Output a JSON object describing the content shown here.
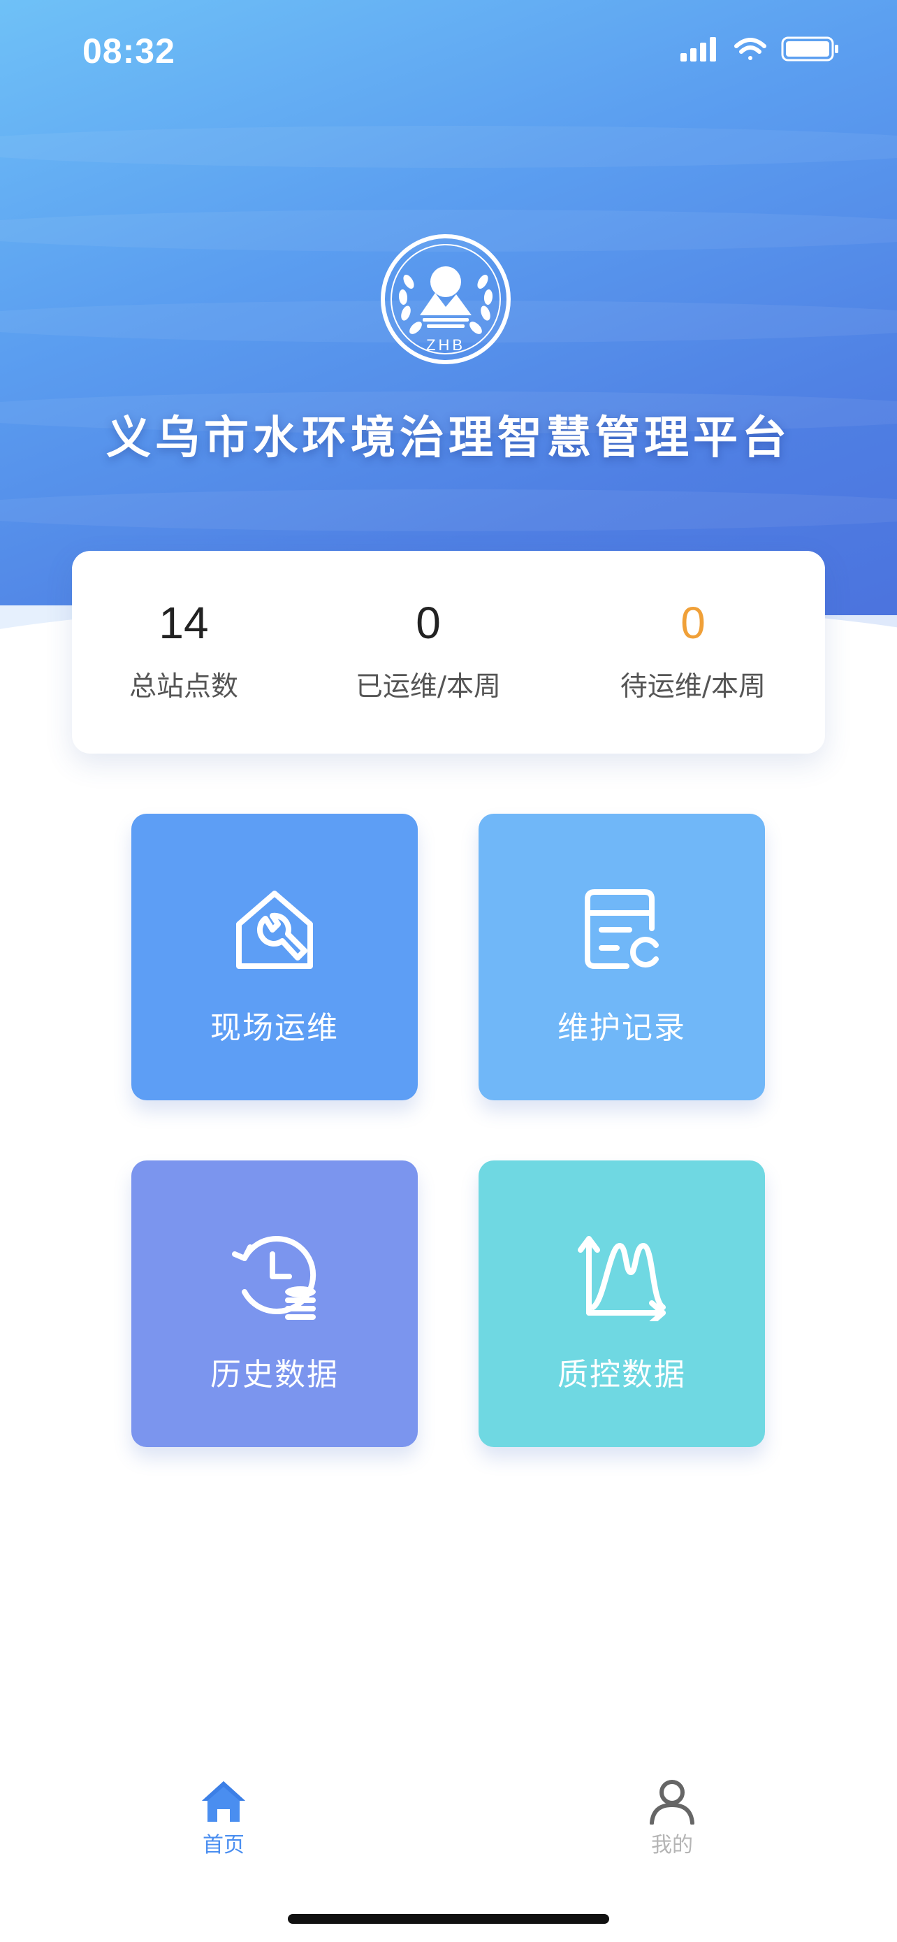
{
  "status_bar": {
    "time": "08:32"
  },
  "header": {
    "title": "义乌市水环境治理智慧管理平台",
    "logo_text": "ZHB"
  },
  "stats": [
    {
      "value": "14",
      "label": "总站点数"
    },
    {
      "value": "0",
      "label": "已运维/本周"
    },
    {
      "value": "0",
      "label": "待运维/本周"
    }
  ],
  "tiles": [
    {
      "label": "现场运维",
      "icon": "house-wrench-icon",
      "color": "#5d9ef5"
    },
    {
      "label": "维护记录",
      "icon": "record-list-icon",
      "color": "#70b7f8"
    },
    {
      "label": "历史数据",
      "icon": "history-database-icon",
      "color": "#7b95ee"
    },
    {
      "label": "质控数据",
      "icon": "peak-chart-icon",
      "color": "#6fd8e2"
    }
  ],
  "tab_bar": {
    "items": [
      {
        "label": "首页",
        "icon": "home-icon",
        "active": true
      },
      {
        "label": "我的",
        "icon": "user-icon",
        "active": false
      }
    ]
  },
  "colors": {
    "accent": "#4a8ef0",
    "pending": "#f0a038"
  }
}
